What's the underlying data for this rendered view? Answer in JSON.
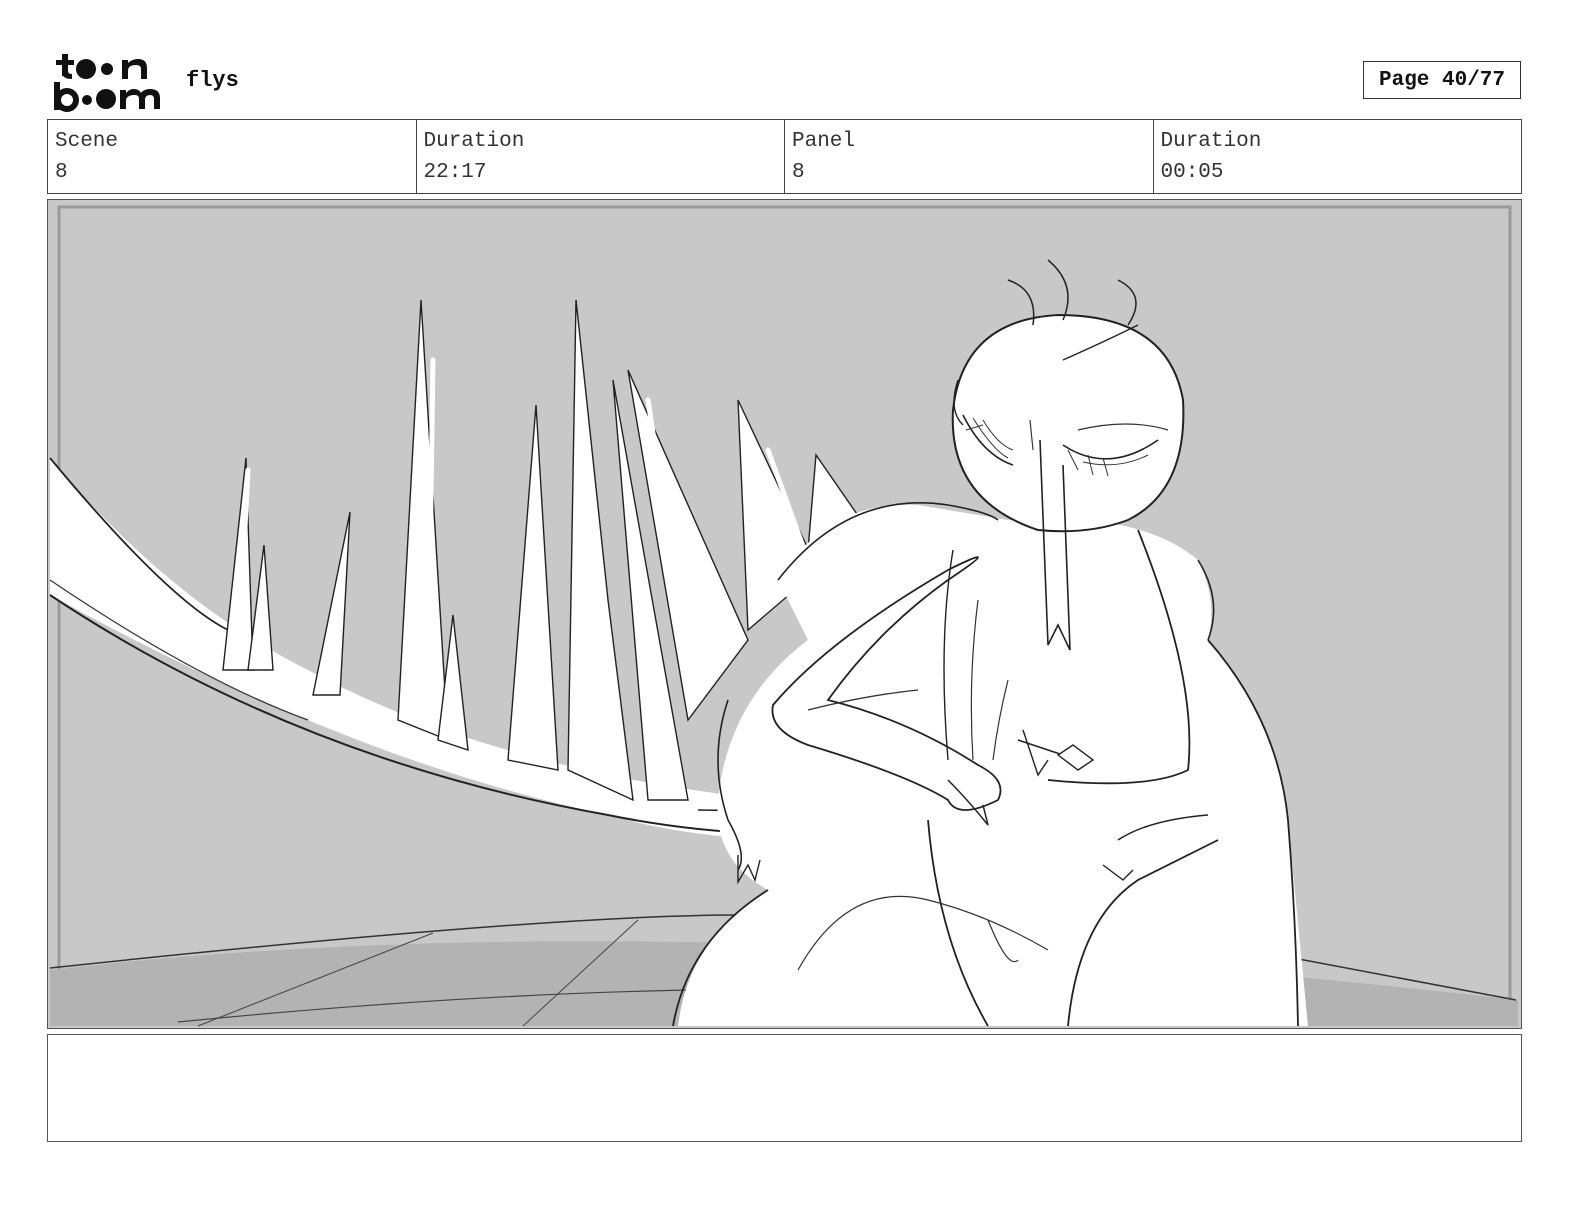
{
  "header": {
    "logo_text": "toon boom",
    "project_title": "flys",
    "page_label": "Page 40/77"
  },
  "info": {
    "scene_label": "Scene",
    "scene_value": "8",
    "scene_duration_label": "Duration",
    "scene_duration_value": "22:17",
    "panel_label": "Panel",
    "panel_value": "8",
    "panel_duration_label": "Duration",
    "panel_duration_value": "00:05"
  },
  "notes": {
    "text": ""
  }
}
